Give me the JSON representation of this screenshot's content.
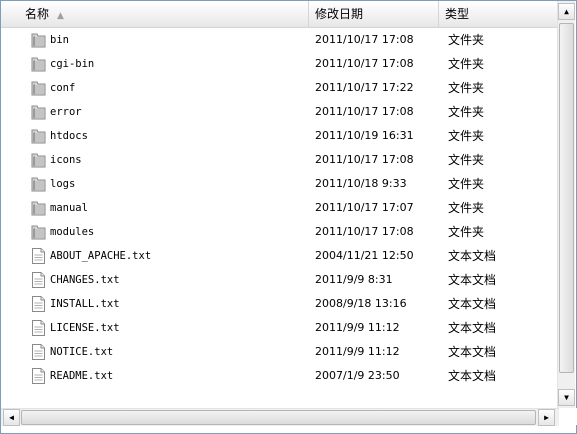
{
  "columns": {
    "name": "名称",
    "modified": "修改日期",
    "type": "类型",
    "sort_indicator": "▲"
  },
  "rows": [
    {
      "name": "bin",
      "date": "2011/10/17 17:08",
      "type": "文件夹",
      "icon": "folder-icon"
    },
    {
      "name": "cgi-bin",
      "date": "2011/10/17 17:08",
      "type": "文件夹",
      "icon": "folder-icon"
    },
    {
      "name": "conf",
      "date": "2011/10/17 17:22",
      "type": "文件夹",
      "icon": "folder-icon"
    },
    {
      "name": "error",
      "date": "2011/10/17 17:08",
      "type": "文件夹",
      "icon": "folder-icon"
    },
    {
      "name": "htdocs",
      "date": "2011/10/19 16:31",
      "type": "文件夹",
      "icon": "folder-icon"
    },
    {
      "name": "icons",
      "date": "2011/10/17 17:08",
      "type": "文件夹",
      "icon": "folder-icon"
    },
    {
      "name": "logs",
      "date": "2011/10/18 9:33",
      "type": "文件夹",
      "icon": "folder-icon"
    },
    {
      "name": "manual",
      "date": "2011/10/17 17:07",
      "type": "文件夹",
      "icon": "folder-icon"
    },
    {
      "name": "modules",
      "date": "2011/10/17 17:08",
      "type": "文件夹",
      "icon": "folder-icon"
    },
    {
      "name": "ABOUT_APACHE.txt",
      "date": "2004/11/21 12:50",
      "type": "文本文档",
      "icon": "text-file-icon"
    },
    {
      "name": "CHANGES.txt",
      "date": "2011/9/9 8:31",
      "type": "文本文档",
      "icon": "text-file-icon"
    },
    {
      "name": "INSTALL.txt",
      "date": "2008/9/18 13:16",
      "type": "文本文档",
      "icon": "text-file-icon"
    },
    {
      "name": "LICENSE.txt",
      "date": "2011/9/9 11:12",
      "type": "文本文档",
      "icon": "text-file-icon"
    },
    {
      "name": "NOTICE.txt",
      "date": "2011/9/9 11:12",
      "type": "文本文档",
      "icon": "text-file-icon"
    },
    {
      "name": "README.txt",
      "date": "2007/1/9 23:50",
      "type": "文本文档",
      "icon": "text-file-icon"
    }
  ],
  "scrollbars": {
    "up_arrow": "▲",
    "down_arrow": "▼",
    "left_arrow": "◀",
    "right_arrow": "▶"
  }
}
